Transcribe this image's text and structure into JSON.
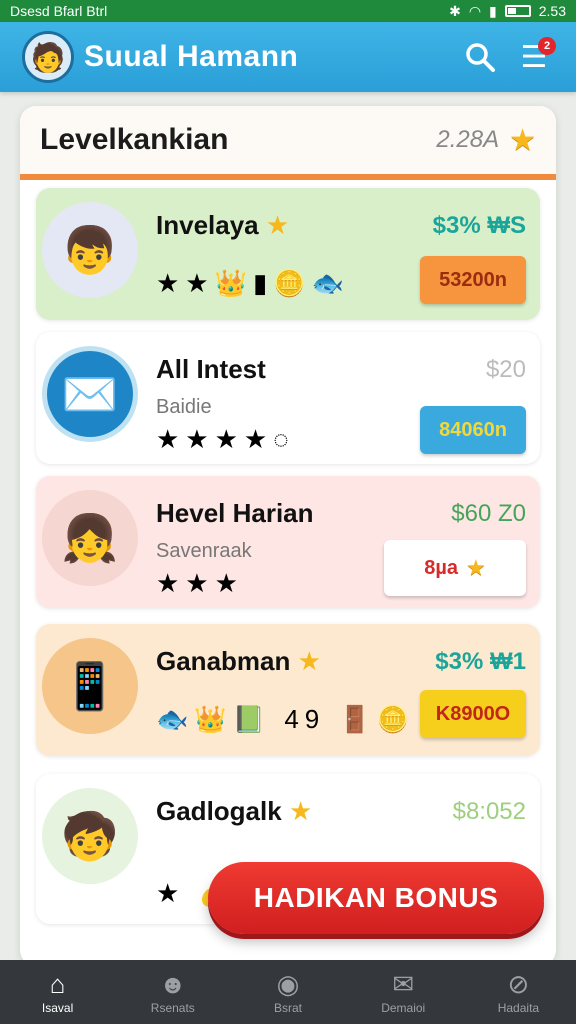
{
  "status_bar": {
    "left_text": "Dsesd Bfarl Btrl",
    "time": "2.53"
  },
  "app_bar": {
    "title": "Suual Hamann",
    "notification_count": "2"
  },
  "panel": {
    "title": "Levelkankian",
    "score": "2.28A"
  },
  "cards": [
    {
      "title": "Invelaya",
      "subtitle": "",
      "amount": "$3% ₩S",
      "button": "53200n",
      "row": "★★👑▮🪙🐟"
    },
    {
      "title": "All Intest",
      "subtitle": "Baidie",
      "amount": "$20",
      "button": "84060n",
      "row": "★★★★◌"
    },
    {
      "title": "Hevel Harian",
      "subtitle": "Savenraak",
      "amount": "$60 Z0",
      "button": "8µa",
      "row": "★★★"
    },
    {
      "title": "Ganabman",
      "subtitle": "",
      "amount": "$3% ₩1",
      "button": "K8900O",
      "row": "🐟👑📗 49 🚪🪙"
    },
    {
      "title": "Gadlogalk",
      "subtitle": "",
      "amount": "$8:052",
      "button": "",
      "row": "★ 💰"
    }
  ],
  "bonus_button": "HADIKAN BONUS",
  "nav": [
    {
      "label": "Isaval",
      "icon": "home-icon"
    },
    {
      "label": "Rsenats",
      "icon": "profile-icon"
    },
    {
      "label": "Bsrat",
      "icon": "game-icon"
    },
    {
      "label": "Demaioi",
      "icon": "mail-icon"
    },
    {
      "label": "Hadaita",
      "icon": "search-icon"
    }
  ],
  "colors": {
    "accent": "#2a9fd8",
    "bonus": "#e0282a",
    "status_bar": "#1f8a3c",
    "header_rule": "#f08a3c"
  }
}
